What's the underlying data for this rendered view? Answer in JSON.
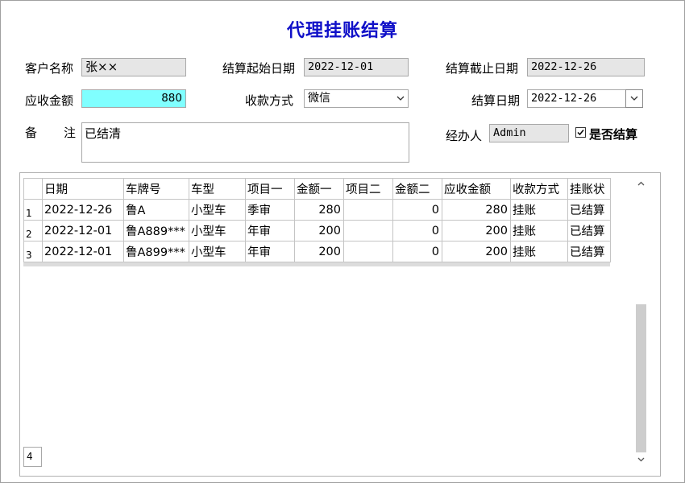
{
  "title": "代理挂账结算",
  "form": {
    "customer_name_label": "客户名称",
    "customer_name_value": "张××",
    "start_date_label": "结算起始日期",
    "start_date_value": "2022-12-01",
    "end_date_label": "结算截止日期",
    "end_date_value": "2022-12-26",
    "receivable_label": "应收金额",
    "receivable_value": "880",
    "payment_method_label": "收款方式",
    "payment_method_value": "微信",
    "settle_date_label": "结算日期",
    "settle_date_value": "2022-12-26",
    "remark_label_1": "备",
    "remark_label_2": "注",
    "remark_value": "已结清",
    "operator_label": "经办人",
    "operator_value": "Admin",
    "settled_checked": true,
    "settled_label": "是否结算"
  },
  "grid": {
    "columns": [
      "日期",
      "车牌号",
      "车型",
      "项目一",
      "金额一",
      "项目二",
      "金额二",
      "应收金额",
      "收款方式",
      "挂账状"
    ],
    "rows": [
      [
        "1",
        "2022-12-26",
        "鲁A",
        "小型车",
        "季审",
        "280",
        "",
        "0",
        "280",
        "挂账",
        "已结算"
      ],
      [
        "2",
        "2022-12-01",
        "鲁A889***",
        "小型车",
        "年审",
        "200",
        "",
        "0",
        "200",
        "挂账",
        "已结算"
      ],
      [
        "3",
        "2022-12-01",
        "鲁A899***",
        "小型车",
        "年审",
        "200",
        "",
        "0",
        "200",
        "挂账",
        "已结算"
      ]
    ],
    "record_count": "4"
  },
  "icons": {
    "dropdown": "chevron-down-icon",
    "scroll_up": "chevron-up-icon",
    "scroll_down": "chevron-down-icon",
    "checkbox": "checkmark-icon"
  },
  "colors": {
    "title": "#1010c8",
    "receivable_bg": "#80ffff",
    "readonly_bg": "#e6e6e6"
  }
}
